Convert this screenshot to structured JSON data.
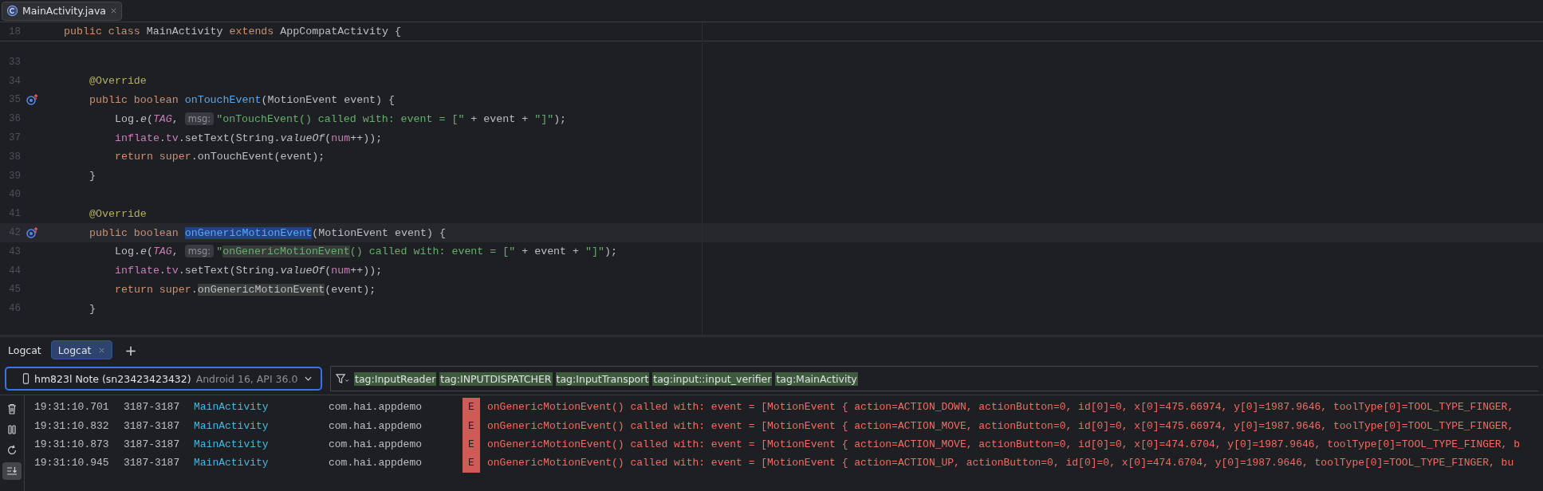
{
  "editor_tabs": [
    {
      "label": "MainActivity.java",
      "selected": true
    }
  ],
  "sticky_line": {
    "number": "18",
    "kind": "class",
    "tokens": [
      {
        "t": "public class ",
        "kind": "kw"
      },
      {
        "t": "MainActivity ",
        "kind": "pl"
      },
      {
        "t": "extends ",
        "kind": "kw"
      },
      {
        "t": "AppCompatActivity {",
        "kind": "pl"
      }
    ]
  },
  "code_lines": [
    {
      "number": "33",
      "marker": false,
      "current": false
    },
    {
      "number": "34",
      "kind": "member",
      "marker": false,
      "current": false,
      "tokens": [
        {
          "t": "@Override",
          "kind": "ann"
        }
      ]
    },
    {
      "number": "35",
      "kind": "member",
      "marker": true,
      "current": false,
      "tokens": [
        {
          "t": "public boolean ",
          "kind": "kw"
        },
        {
          "t": "onTouchEvent",
          "kind": "fn"
        },
        {
          "t": "(MotionEvent event) {",
          "kind": "pl"
        }
      ]
    },
    {
      "number": "36",
      "kind": "body",
      "marker": false,
      "current": false,
      "tokens": [
        {
          "t": "Log.",
          "kind": "pl"
        },
        {
          "t": "e",
          "kind": "it"
        },
        {
          "t": "(",
          "kind": "pl"
        },
        {
          "t": "TAG",
          "kind": "itf"
        },
        {
          "t": ", ",
          "kind": "pl"
        },
        {
          "t": "msg:",
          "kind": "hint"
        },
        {
          "t": "\"onTouchEvent() called with: event = [\"",
          "kind": "str"
        },
        {
          "t": " + event + ",
          "kind": "pl"
        },
        {
          "t": "\"]\"",
          "kind": "str"
        },
        {
          "t": ");",
          "kind": "pl"
        }
      ]
    },
    {
      "number": "37",
      "kind": "body",
      "marker": false,
      "current": false,
      "tokens": [
        {
          "t": "inflate",
          "kind": "fld"
        },
        {
          "t": ".",
          "kind": "pl"
        },
        {
          "t": "tv",
          "kind": "fld"
        },
        {
          "t": ".setText(String.",
          "kind": "pl"
        },
        {
          "t": "valueOf",
          "kind": "it"
        },
        {
          "t": "(",
          "kind": "pl"
        },
        {
          "t": "num",
          "kind": "fld"
        },
        {
          "t": "++));",
          "kind": "pl"
        }
      ]
    },
    {
      "number": "38",
      "kind": "body",
      "marker": false,
      "current": false,
      "tokens": [
        {
          "t": "return ",
          "kind": "kw"
        },
        {
          "t": "super",
          "kind": "kw"
        },
        {
          "t": ".onTouchEvent(event);",
          "kind": "pl"
        }
      ]
    },
    {
      "number": "39",
      "kind": "member",
      "marker": false,
      "current": false,
      "tokens": [
        {
          "t": "}",
          "kind": "pl"
        }
      ]
    },
    {
      "number": "40",
      "marker": false,
      "current": false
    },
    {
      "number": "41",
      "kind": "member",
      "marker": false,
      "current": false,
      "tokens": [
        {
          "t": "@Override",
          "kind": "ann"
        }
      ]
    },
    {
      "number": "42",
      "kind": "member",
      "marker": true,
      "current": true,
      "tokens": [
        {
          "t": "public boolean ",
          "kind": "kw"
        },
        {
          "t": "onGenericMotionEvent",
          "kind": "sel"
        },
        {
          "t": "(MotionEvent event) {",
          "kind": "pl"
        }
      ]
    },
    {
      "number": "43",
      "kind": "body",
      "marker": false,
      "current": false,
      "tokens": [
        {
          "t": "Log.",
          "kind": "pl"
        },
        {
          "t": "e",
          "kind": "it"
        },
        {
          "t": "(",
          "kind": "pl"
        },
        {
          "t": "TAG",
          "kind": "itf"
        },
        {
          "t": ", ",
          "kind": "pl"
        },
        {
          "t": "msg:",
          "kind": "hint"
        },
        {
          "t": "\"",
          "kind": "str"
        },
        {
          "t": "onGenericMotionEvent",
          "kind": "strhl"
        },
        {
          "t": "() called with: event = [\"",
          "kind": "str"
        },
        {
          "t": " + event + ",
          "kind": "pl"
        },
        {
          "t": "\"]\"",
          "kind": "str"
        },
        {
          "t": ");",
          "kind": "pl"
        }
      ]
    },
    {
      "number": "44",
      "kind": "body",
      "marker": false,
      "current": false,
      "tokens": [
        {
          "t": "inflate",
          "kind": "fld"
        },
        {
          "t": ".",
          "kind": "pl"
        },
        {
          "t": "tv",
          "kind": "fld"
        },
        {
          "t": ".setText(String.",
          "kind": "pl"
        },
        {
          "t": "valueOf",
          "kind": "it"
        },
        {
          "t": "(",
          "kind": "pl"
        },
        {
          "t": "num",
          "kind": "fld"
        },
        {
          "t": "++));",
          "kind": "pl"
        }
      ]
    },
    {
      "number": "45",
      "kind": "body",
      "marker": false,
      "current": false,
      "tokens": [
        {
          "t": "return ",
          "kind": "kw"
        },
        {
          "t": "super",
          "kind": "kw"
        },
        {
          "t": ".",
          "kind": "pl"
        },
        {
          "t": "onGenericMotionEvent",
          "kind": "usage"
        },
        {
          "t": "(event);",
          "kind": "pl"
        }
      ]
    },
    {
      "number": "46",
      "kind": "member",
      "marker": false,
      "current": false,
      "tokens": [
        {
          "t": "}",
          "kind": "pl"
        }
      ]
    }
  ],
  "logcat": {
    "title": "Logcat",
    "tabs": [
      {
        "label": "Logcat",
        "selected": true
      }
    ],
    "add_tab": "+",
    "device": {
      "name": "hm823l Note (sn23423423432)",
      "detail": "Android 16, API 36.0"
    },
    "filters": [
      "tag:InputReader",
      "tag:INPUTDISPATCHER",
      "tag:InputTransport",
      "tag:input::input_verifier",
      "tag:MainActivity"
    ],
    "toolbar": [
      {
        "kind": "clear",
        "on": false
      },
      {
        "kind": "pause",
        "on": false
      },
      {
        "kind": "restart",
        "on": false
      },
      {
        "kind": "scroll_end",
        "on": true
      }
    ],
    "rows": [
      {
        "time": "19:31:10.701",
        "pid": "3187-3187",
        "tag": "MainActivity",
        "package": "com.hai.appdemo",
        "level": "E",
        "message": "onGenericMotionEvent() called with: event = [MotionEvent { action=ACTION_DOWN, actionButton=0, id[0]=0, x[0]=475.66974, y[0]=1987.9646, toolType[0]=TOOL_TYPE_FINGER,"
      },
      {
        "time": "19:31:10.832",
        "pid": "3187-3187",
        "tag": "MainActivity",
        "package": "com.hai.appdemo",
        "level": "E",
        "message": "onGenericMotionEvent() called with: event = [MotionEvent { action=ACTION_MOVE, actionButton=0, id[0]=0, x[0]=475.66974, y[0]=1987.9646, toolType[0]=TOOL_TYPE_FINGER,"
      },
      {
        "time": "19:31:10.873",
        "pid": "3187-3187",
        "tag": "MainActivity",
        "package": "com.hai.appdemo",
        "level": "E",
        "message": "onGenericMotionEvent() called with: event = [MotionEvent { action=ACTION_MOVE, actionButton=0, id[0]=0, x[0]=474.6704, y[0]=1987.9646, toolType[0]=TOOL_TYPE_FINGER, b"
      },
      {
        "time": "19:31:10.945",
        "pid": "3187-3187",
        "tag": "MainActivity",
        "package": "com.hai.appdemo",
        "level": "E",
        "message": "onGenericMotionEvent() called with: event = [MotionEvent { action=ACTION_UP, actionButton=0, id[0]=0, x[0]=474.6704, y[0]=1987.9646, toolType[0]=TOOL_TYPE_FINGER, bu"
      }
    ]
  }
}
